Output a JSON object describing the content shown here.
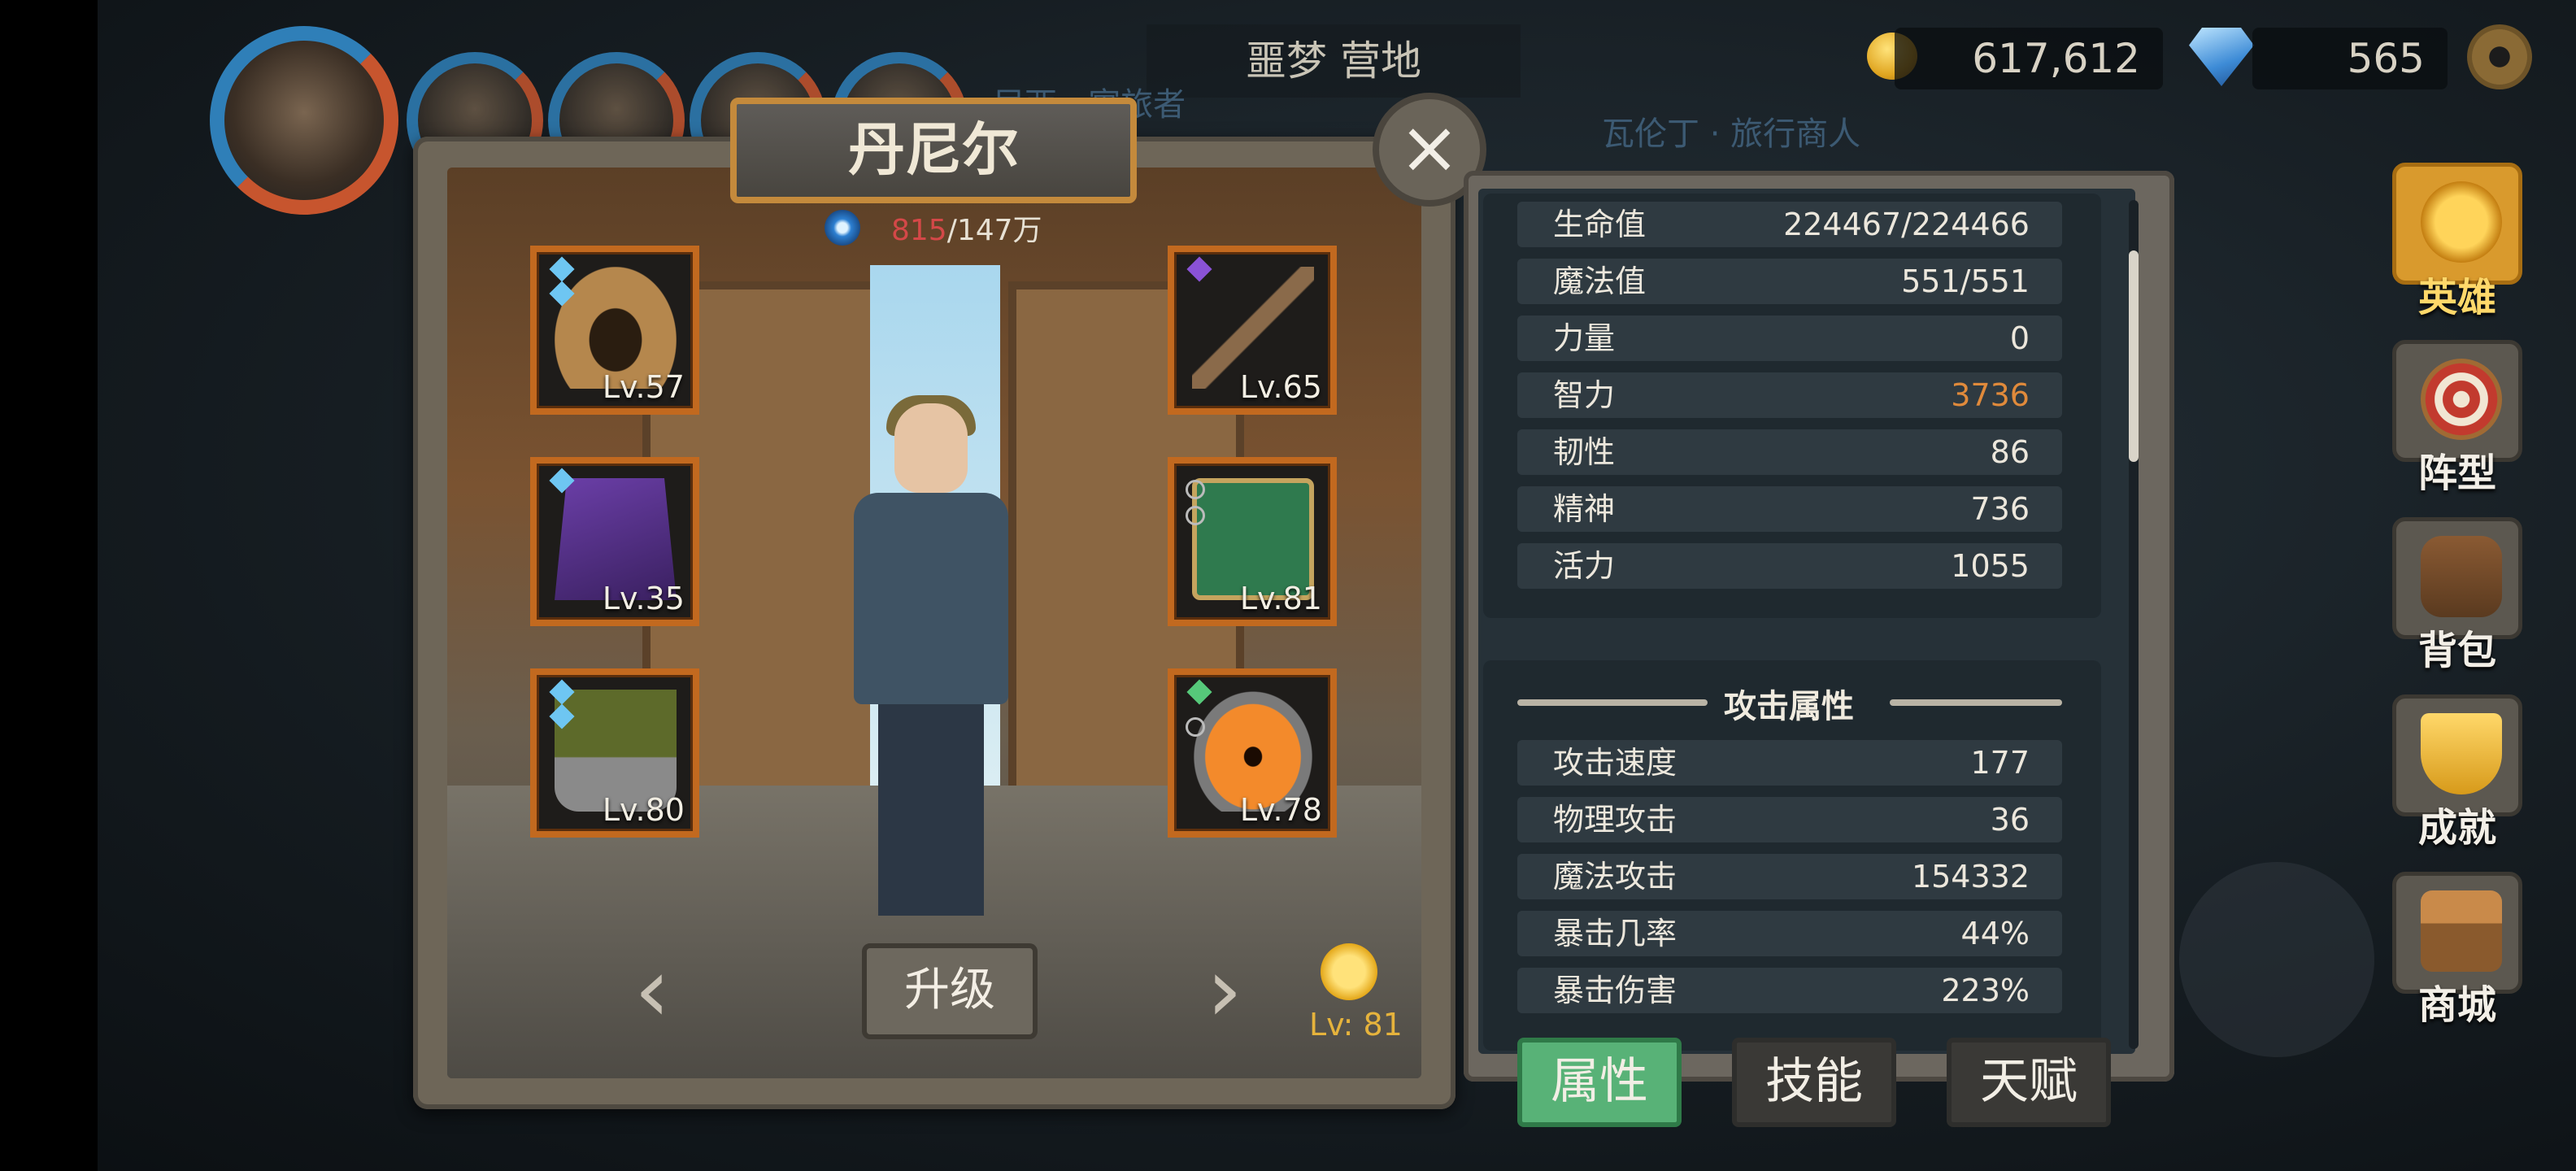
{
  "header": {
    "location": "噩梦 营地",
    "ghost_text_1": "尼西 · 寓旅者",
    "ghost_text_2": "瓦伦丁 · 旅行商人",
    "gold": "617,612",
    "gems": "565"
  },
  "hero": {
    "name": "丹尼尔",
    "xp_current": "815",
    "xp_total": "/147万",
    "upgrade_label": "升级",
    "level_label": "Lv: 81"
  },
  "equipment": [
    {
      "slot": "helmet",
      "level": "Lv.57"
    },
    {
      "slot": "armor",
      "level": "Lv.35"
    },
    {
      "slot": "boots",
      "level": "Lv.80"
    },
    {
      "slot": "weapon",
      "level": "Lv.65"
    },
    {
      "slot": "book",
      "level": "Lv.81"
    },
    {
      "slot": "amulet",
      "level": "Lv.78"
    }
  ],
  "stats": {
    "base": [
      {
        "name": "生命值",
        "value": "224467/224466"
      },
      {
        "name": "魔法值",
        "value": "551/551"
      },
      {
        "name": "力量",
        "value": "0"
      },
      {
        "name": "智力",
        "value": "3736"
      },
      {
        "name": "韧性",
        "value": "86"
      },
      {
        "name": "精神",
        "value": "736"
      },
      {
        "name": "活力",
        "value": "1055"
      }
    ],
    "attack_title": "攻击属性",
    "attack": [
      {
        "name": "攻击速度",
        "value": "177"
      },
      {
        "name": "物理攻击",
        "value": "36"
      },
      {
        "name": "魔法攻击",
        "value": "154332"
      },
      {
        "name": "暴击几率",
        "value": "44%"
      },
      {
        "name": "暴击伤害",
        "value": "223%"
      }
    ]
  },
  "tabs": [
    "属性",
    "技能",
    "天赋"
  ],
  "nav": [
    "英雄",
    "阵型",
    "背包",
    "成就",
    "商城"
  ],
  "colors": {
    "accent_active_tab": "#58b277",
    "highlight_value": "#e08a3b",
    "slot_border": "#c2691f"
  }
}
